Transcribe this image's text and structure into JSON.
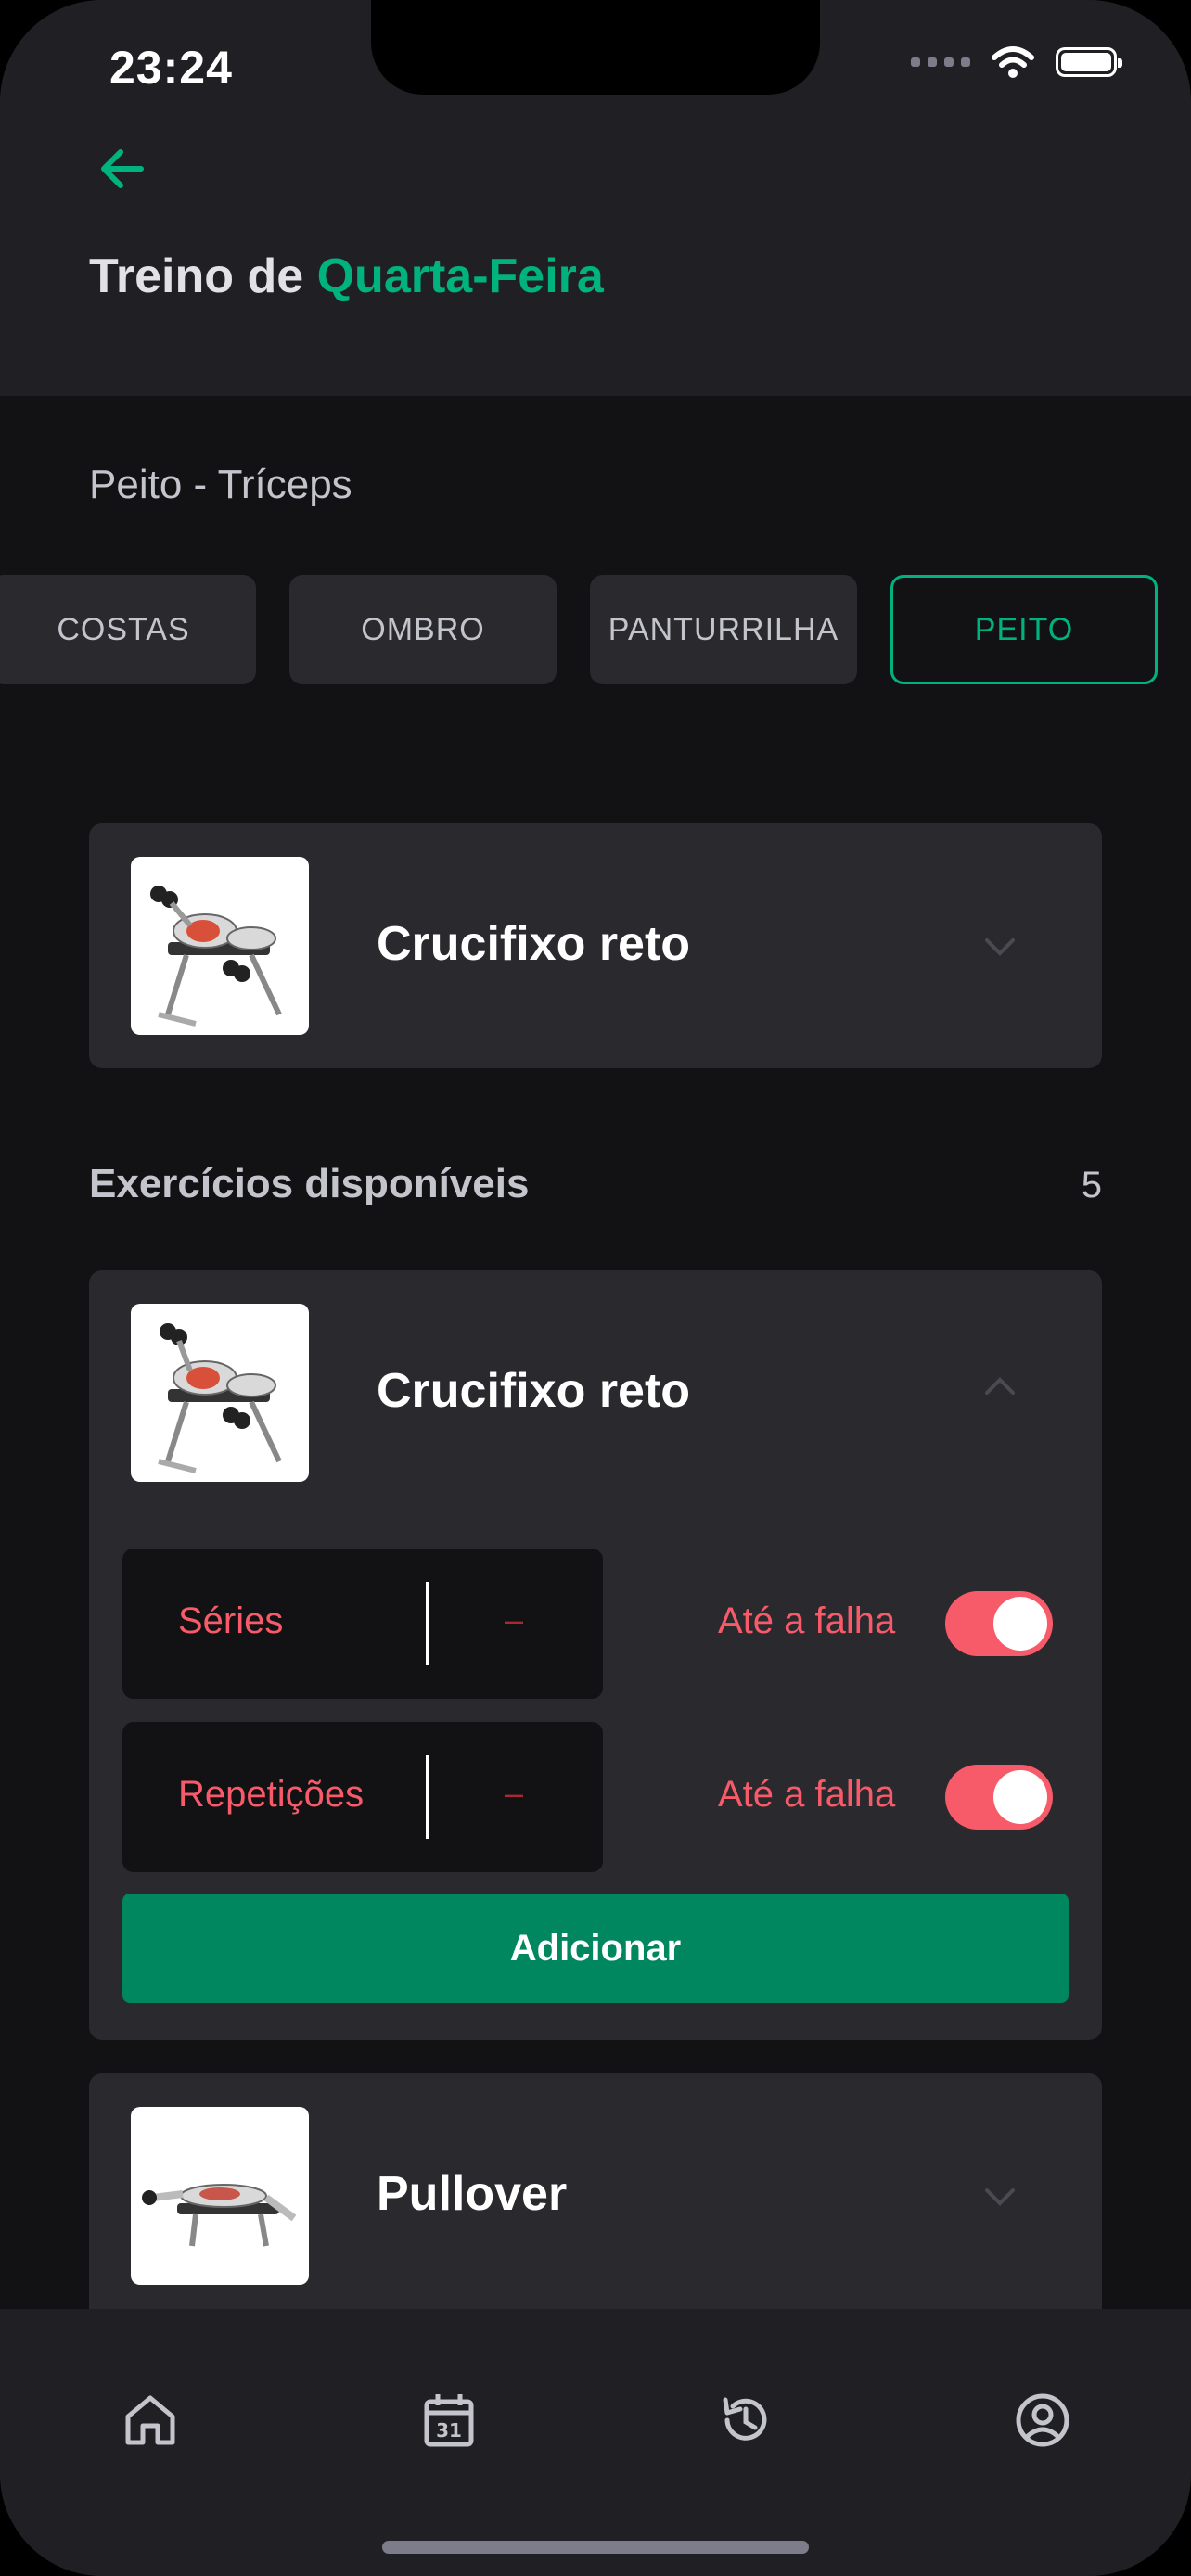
{
  "status_bar": {
    "time": "23:24"
  },
  "header": {
    "title_prefix": "Treino de ",
    "title_day": "Quarta-Feira"
  },
  "subtitle": "Peito - Tríceps",
  "categories": [
    {
      "label": "COSTAS",
      "active": false
    },
    {
      "label": "OMBRO",
      "active": false
    },
    {
      "label": "PANTURRILHA",
      "active": false
    },
    {
      "label": "PEITO",
      "active": true
    }
  ],
  "selected_exercise": {
    "name": "Crucifixo reto"
  },
  "available": {
    "title": "Exercícios disponíveis",
    "count": "5",
    "items": [
      {
        "name": "Crucifixo reto",
        "expanded": true,
        "series_label": "Séries",
        "series_value": "–",
        "reps_label": "Repetições",
        "reps_value": "–",
        "failure_label": "Até a falha",
        "failure_series": true,
        "failure_reps": true,
        "add_label": "Adicionar"
      },
      {
        "name": "Pullover",
        "expanded": false
      }
    ]
  },
  "tabbar": {
    "items": [
      "home-icon",
      "calendar-icon",
      "history-icon",
      "profile-icon"
    ],
    "calendar_day": "31"
  },
  "colors": {
    "accent": "#00b37e",
    "danger": "#f75a68",
    "button": "#00875f",
    "background": "#121214",
    "card": "#29292e"
  }
}
